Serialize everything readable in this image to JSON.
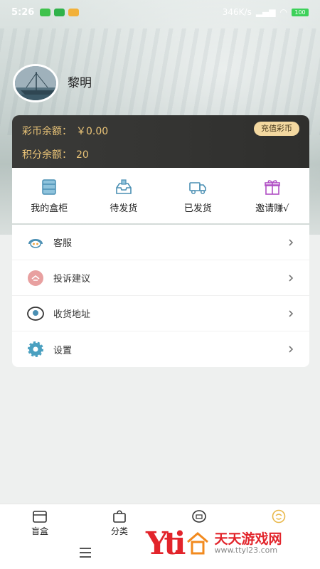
{
  "status_bar": {
    "time": "5:26",
    "speed": "346K/s",
    "battery": "100"
  },
  "profile": {
    "username": "黎明"
  },
  "balance": {
    "coin_label": "彩币余额：",
    "coin_value": "￥0.00",
    "points_label": "积分余额：",
    "points_value": "20",
    "recharge_label": "充值彩币"
  },
  "orders": [
    {
      "label": "我的盒柜",
      "icon": "box-cabinet-icon"
    },
    {
      "label": "待发货",
      "icon": "tray-box-icon"
    },
    {
      "label": "已发货",
      "icon": "truck-icon"
    },
    {
      "label": "邀请赚√",
      "icon": "gift-icon"
    }
  ],
  "menu": [
    {
      "label": "客服",
      "icon": "headset-icon"
    },
    {
      "label": "投诉建议",
      "icon": "feedback-icon"
    },
    {
      "label": "收货地址",
      "icon": "location-pin-icon"
    },
    {
      "label": "设置",
      "icon": "gear-icon"
    }
  ],
  "tabbar": [
    {
      "label": "盲盒",
      "icon": "blind-box-icon"
    },
    {
      "label": "分类",
      "icon": "bag-icon"
    },
    {
      "label": "",
      "icon": "coin-icon"
    },
    {
      "label": "",
      "icon": "profile-icon"
    }
  ],
  "watermark": {
    "brand": "天天游戏网",
    "url": "www.ttyl23.com"
  },
  "colors": {
    "gold": "#e9c377",
    "card_dark": "#333331",
    "accent_purple": "#b04fc4",
    "accent_blue": "#4a8fb3",
    "watermark_red": "#e2242b",
    "watermark_orange": "#f28a1e"
  }
}
